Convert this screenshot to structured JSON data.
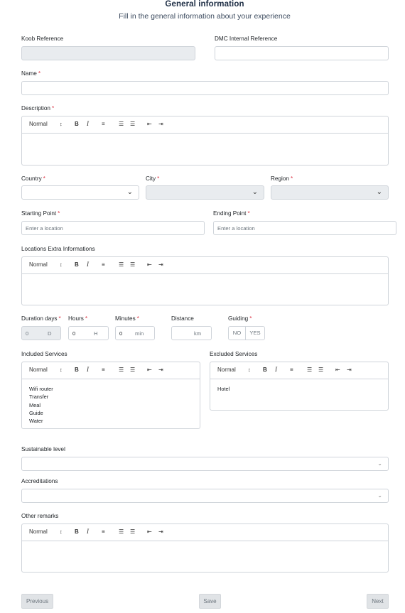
{
  "header": {
    "title": "General information",
    "subtitle": "Fill in the general information about your experience"
  },
  "fields": {
    "koob_reference": {
      "label": "Koob Reference",
      "value": ""
    },
    "dmc_reference": {
      "label": "DMC Internal Reference",
      "value": ""
    },
    "name": {
      "label": "Name",
      "required": "*",
      "value": ""
    },
    "description": {
      "label": "Description",
      "required": "*"
    },
    "country": {
      "label": "Country",
      "required": "*"
    },
    "city": {
      "label": "City",
      "required": "*"
    },
    "region": {
      "label": "Region",
      "required": "*"
    },
    "starting_point": {
      "label": "Starting Point",
      "required": "*",
      "placeholder": "Enter a location"
    },
    "ending_point": {
      "label": "Ending Point",
      "required": "*",
      "placeholder": "Enter a location"
    },
    "locations_extra": {
      "label": "Locations Extra Informations"
    },
    "duration_days": {
      "label": "Duration days",
      "required": "*",
      "value": "0",
      "unit": "D"
    },
    "hours": {
      "label": "Hours",
      "required": "*",
      "value": "0",
      "unit": "H"
    },
    "minutes": {
      "label": "Minutes",
      "required": "*",
      "value": "0",
      "unit": "min"
    },
    "distance": {
      "label": "Distance",
      "value": "",
      "unit": "km"
    },
    "guiding": {
      "label": "Guiding",
      "required": "*",
      "no": "NO",
      "yes": "YES"
    },
    "included_services": {
      "label": "Included Services",
      "items": [
        "Wifi router",
        "Transfer",
        "Meal",
        "Guide",
        "Water"
      ]
    },
    "excluded_services": {
      "label": "Excluded Services",
      "items": [
        "Hotel"
      ]
    },
    "sustainable_level": {
      "label": "Sustainable level"
    },
    "accreditations": {
      "label": "Accreditations"
    },
    "other_remarks": {
      "label": "Other remarks"
    }
  },
  "editor_toolbar": {
    "format": "Normal",
    "format_arrows": "↕",
    "bold": "B",
    "italic": "I",
    "align_icon": "align-left-icon",
    "ordered_list_icon": "ordered-list-icon",
    "bullet_list_icon": "bullet-list-icon",
    "outdent_icon": "outdent-icon",
    "indent_icon": "indent-icon"
  },
  "buttons": {
    "previous": "Previous",
    "save": "Save",
    "next": "Next"
  },
  "colors": {
    "title": "#1d2d44",
    "required": "#dc3545",
    "border": "#cfd4da",
    "disabled_bg": "#e9ecef",
    "button_bg": "#e0e3e6"
  }
}
